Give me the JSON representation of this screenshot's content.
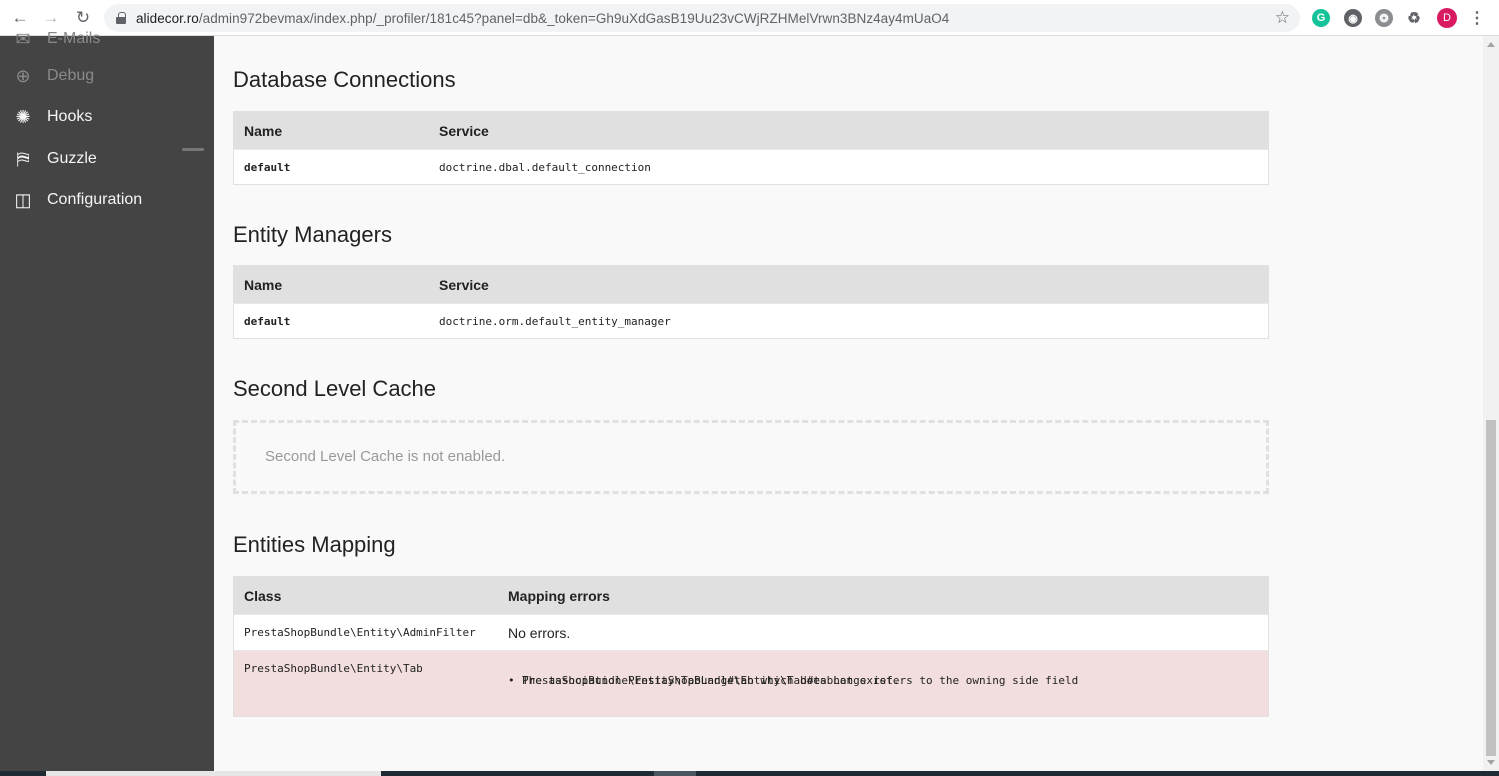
{
  "browser": {
    "url_host": "alidecor.ro",
    "url_path": "/admin972bevmax/index.php/_profiler/181c45?panel=db&_token=Gh9uXdGasB19Uu23vCWjRZHMelVrwn3BNz4ay4mUaO4",
    "avatar_letter": "D",
    "ext_g": "G"
  },
  "sidebar": {
    "items": [
      {
        "label": "E-Mails",
        "icon": "mail-icon",
        "state": "partially-hidden"
      },
      {
        "label": "Debug",
        "icon": "crosshair-icon",
        "state": "disabled"
      },
      {
        "label": "Hooks",
        "icon": "hooks-icon",
        "state": "normal"
      },
      {
        "label": "Guzzle",
        "icon": "fuel-icon",
        "state": "normal"
      },
      {
        "label": "Configuration",
        "icon": "toggle-icon",
        "state": "normal"
      }
    ]
  },
  "sections": {
    "connections": {
      "title": "Database Connections",
      "columns": [
        "Name",
        "Service"
      ],
      "rows": [
        [
          "default",
          "doctrine.dbal.default_connection"
        ]
      ]
    },
    "managers": {
      "title": "Entity Managers",
      "columns": [
        "Name",
        "Service"
      ],
      "rows": [
        [
          "default",
          "doctrine.orm.default_entity_manager"
        ]
      ]
    },
    "cache": {
      "title": "Second Level Cache",
      "message": "Second Level Cache is not enabled."
    },
    "mapping": {
      "title": "Entities Mapping",
      "columns": [
        "Class",
        "Mapping errors"
      ],
      "rows": [
        {
          "class": "PrestaShopBundle\\Entity\\AdminFilter",
          "result": "No errors."
        },
        {
          "class": "PrestaShopBundle\\Entity\\Tab",
          "error_line1": "The association PrestaShopBundle\\Entity\\Tab#tabLangs refers to the owning side field",
          "error_line2": "PrestaShopBundle\\Entity\\TabLang#tab which does not exist."
        }
      ]
    }
  },
  "colors": {
    "sidebar_bg": "#444444",
    "table_head_bg": "#e0e0e0",
    "error_row_bg": "#f2dede"
  }
}
